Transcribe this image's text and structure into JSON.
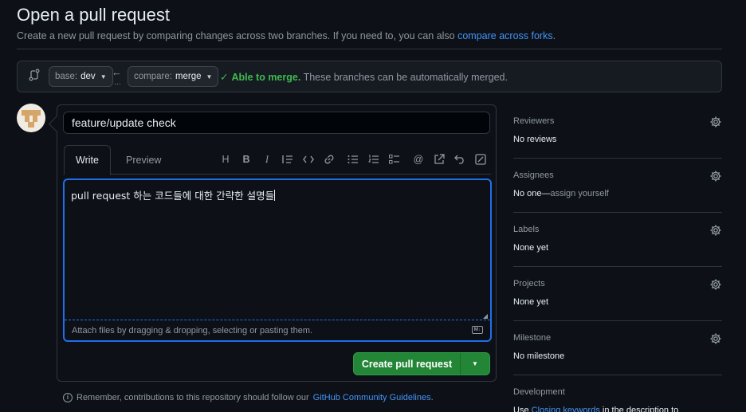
{
  "header": {
    "title": "Open a pull request",
    "subtitle": "Create a new pull request by comparing changes across two branches. If you need to, you can also",
    "subtitle_link": "compare across forks",
    "subtitle_end": "."
  },
  "compare": {
    "base_key": "base:",
    "base_value": "dev",
    "compare_key": "compare:",
    "compare_value": "merge",
    "status_strong": "Able to merge.",
    "status_text": "These branches can be automatically merged."
  },
  "form": {
    "title_value": "feature/update check",
    "tabs": [
      {
        "label": "Write"
      },
      {
        "label": "Preview"
      }
    ],
    "toolbar_icons": [
      "heading-icon",
      "bold-icon",
      "italic-icon",
      "quote-icon",
      "code-icon",
      "link-icon",
      "bulleted-list-icon",
      "numbered-list-icon",
      "task-list-icon",
      "mention-icon",
      "cross-reference-icon",
      "undo-icon",
      "fullscreen-icon"
    ],
    "body_text": "pull request 하는 코드들에 대한 간략한 설명들",
    "attach_text": "Attach files by dragging & dropping, selecting or pasting them.",
    "markdown_badge": "M↓",
    "submit_label": "Create pull request"
  },
  "notice": {
    "text": "Remember, contributions to this repository should follow our",
    "link": "GitHub Community Guidelines",
    "end": "."
  },
  "sidebar": {
    "reviewers": {
      "heading": "Reviewers",
      "value": "No reviews"
    },
    "assignees": {
      "heading": "Assignees",
      "value": "No one—",
      "link": "assign yourself"
    },
    "labels": {
      "heading": "Labels",
      "value": "None yet"
    },
    "projects": {
      "heading": "Projects",
      "value": "None yet"
    },
    "milestone": {
      "heading": "Milestone",
      "value": "No milestone"
    },
    "development": {
      "heading": "Development",
      "value_start": "Use",
      "link": "Closing keywords",
      "value_end": "in the description to"
    }
  },
  "colors": {
    "background": "#0d1117",
    "accent_blue": "#4493f8",
    "success_green": "#3fb950",
    "button_green": "#238636",
    "border": "#30363d"
  }
}
